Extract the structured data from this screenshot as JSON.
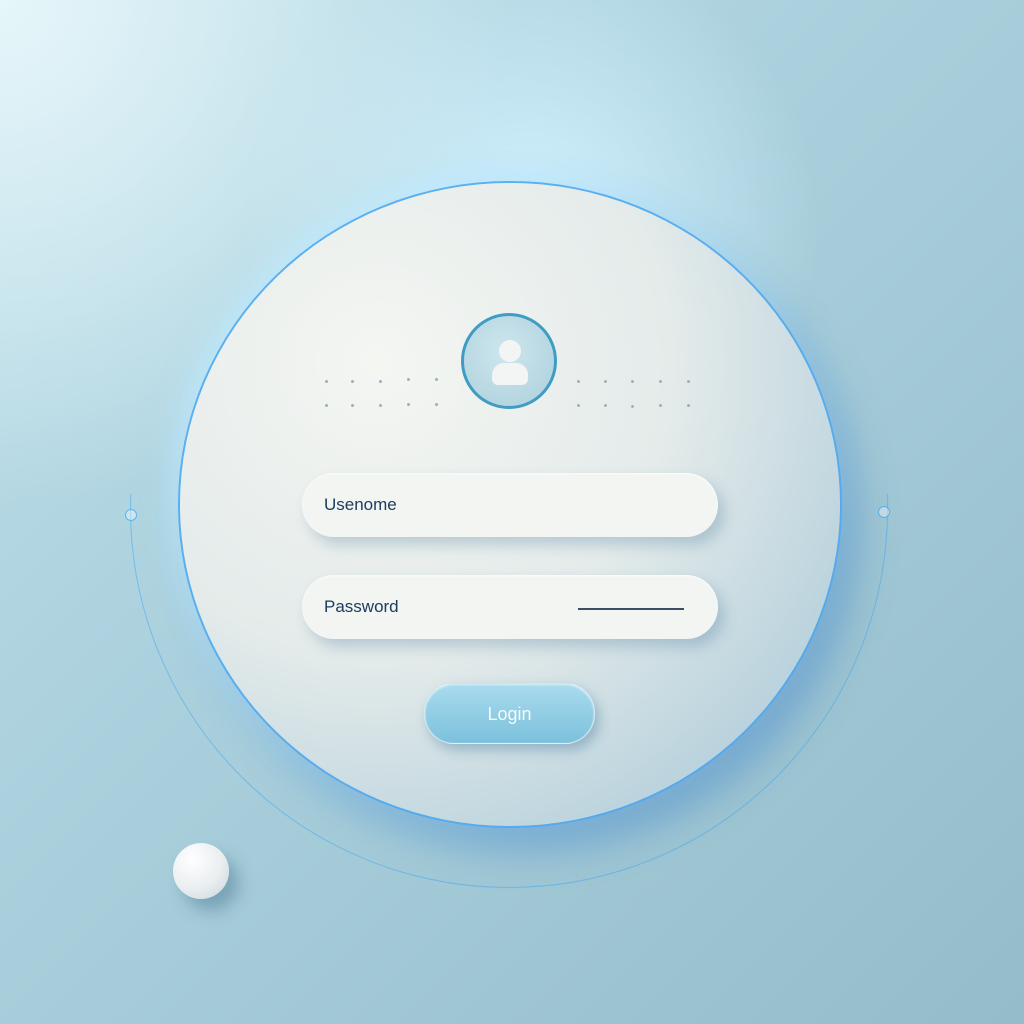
{
  "login_form": {
    "username_placeholder": "Usenome",
    "password_placeholder": "Password",
    "login_label": "Login"
  },
  "icons": {
    "avatar": "user-icon"
  },
  "colors": {
    "accent": "#4aa8e8",
    "button": "#84c6df",
    "text": "#1d3c60"
  }
}
